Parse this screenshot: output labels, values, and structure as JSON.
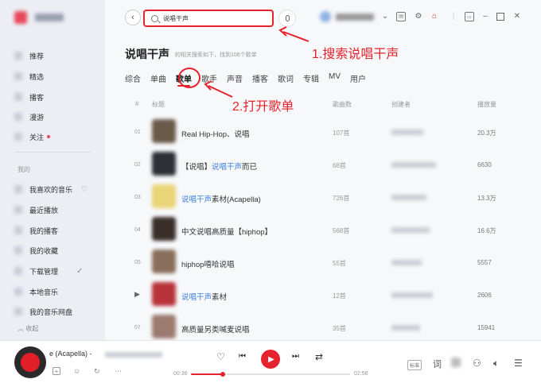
{
  "sidebar": {
    "items": [
      {
        "label": "推荐"
      },
      {
        "label": "精选"
      },
      {
        "label": "播客"
      },
      {
        "label": "漫游"
      },
      {
        "label": "关注"
      }
    ],
    "my_header": "我的",
    "my_items": [
      {
        "label": "我喜欢的音乐"
      },
      {
        "label": "最近播放"
      },
      {
        "label": "我的播客"
      },
      {
        "label": "我的收藏"
      },
      {
        "label": "下载管理"
      },
      {
        "label": "本地音乐"
      },
      {
        "label": "我的音乐网盘"
      }
    ],
    "collapse_label": "收起"
  },
  "search": {
    "value": "说唱干声"
  },
  "results": {
    "title": "说唱干声",
    "subtitle": "的相关搜索如下，找到106个歌单"
  },
  "tabs": [
    {
      "label": "综合"
    },
    {
      "label": "单曲"
    },
    {
      "label": "歌单",
      "active": true
    },
    {
      "label": "歌手"
    },
    {
      "label": "声音"
    },
    {
      "label": "播客"
    },
    {
      "label": "歌词"
    },
    {
      "label": "专辑"
    },
    {
      "label": "MV"
    },
    {
      "label": "用户"
    }
  ],
  "table": {
    "headers": {
      "num": "#",
      "title": "标题",
      "count": "歌曲数",
      "creator": "创建者",
      "plays": "播放量"
    },
    "rows": [
      {
        "num": "01",
        "pre": "Real Hip-Hop、说唱",
        "hl": "",
        "post": "",
        "count": "107首",
        "plays": "20.3万",
        "cover": "#6b5a4a"
      },
      {
        "num": "02",
        "pre": "【说唱】",
        "hl": "说唱干声",
        "post": "而已",
        "count": "68首",
        "plays": "6630",
        "cover": "#2e3038"
      },
      {
        "num": "03",
        "pre": "",
        "hl": "说唱干声",
        "post": "素材(Acapella)",
        "count": "726首",
        "plays": "13.3万",
        "cover": "#e9d478"
      },
      {
        "num": "04",
        "pre": "中文说唱高质量【hiphop】",
        "hl": "",
        "post": "",
        "count": "568首",
        "plays": "16.6万",
        "cover": "#3a2f2a"
      },
      {
        "num": "05",
        "pre": "hiphop嘻哈说唱",
        "hl": "",
        "post": "",
        "count": "55首",
        "plays": "5557",
        "cover": "#8a6e5c"
      },
      {
        "num": "",
        "pre": "",
        "hl": "说唱干声",
        "post": "素材",
        "count": "12首",
        "plays": "2606",
        "cover": "#b8333a",
        "playing": true
      },
      {
        "num": "07",
        "pre": "高质量另类喊麦说唱",
        "hl": "",
        "post": "",
        "count": "35首",
        "plays": "15941",
        "cover": "#9c7a70"
      }
    ]
  },
  "annotations": {
    "step1": "1.搜索说唱干声",
    "step2": "2.打开歌单",
    "color": "#e5232d"
  },
  "player": {
    "song_title": "e (Acapella) -",
    "time_current": "00:36",
    "time_total": "02:58",
    "progress": 0.2,
    "quality": "标准",
    "lyric_label": "词"
  },
  "colors": {
    "accent": "#e5232d",
    "highlight": "#3c7fd8"
  }
}
